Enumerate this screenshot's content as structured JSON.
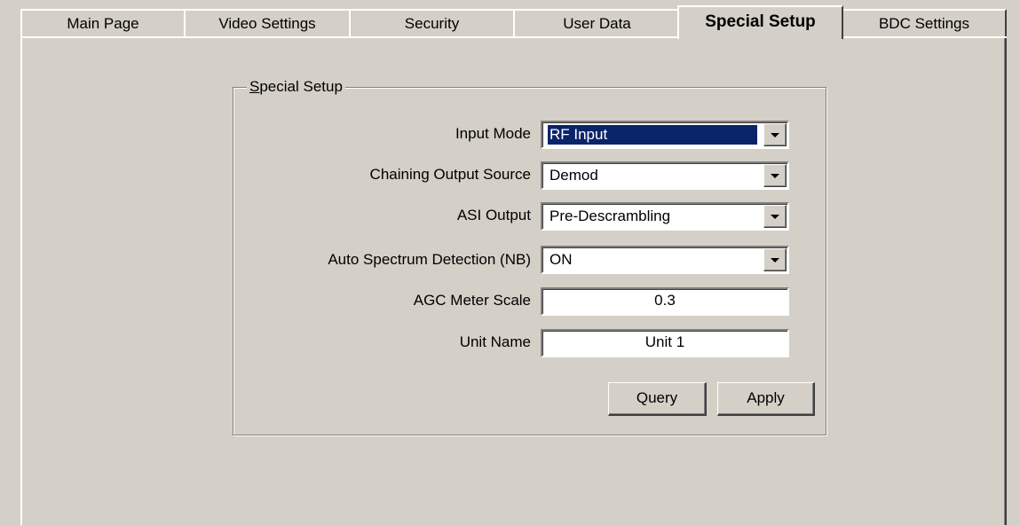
{
  "tabs": [
    {
      "label": "Main Page",
      "active": false
    },
    {
      "label": "Video Settings",
      "active": false
    },
    {
      "label": "Security",
      "active": false
    },
    {
      "label": "User Data",
      "active": false
    },
    {
      "label": "Special Setup",
      "active": true
    },
    {
      "label": "BDC Settings",
      "active": false
    }
  ],
  "group": {
    "title_mnemonic": "S",
    "title_rest": "pecial Setup"
  },
  "fields": {
    "input_mode": {
      "label": "Input Mode",
      "value": "RF Input"
    },
    "chaining_output_source": {
      "label": "Chaining Output Source",
      "value": "Demod"
    },
    "asi_output": {
      "label": "ASI Output",
      "value": "Pre-Descrambling"
    },
    "auto_spectrum_detection": {
      "label": "Auto Spectrum Detection (NB)",
      "value": "ON"
    },
    "agc_meter_scale": {
      "label": "AGC Meter Scale",
      "value": "0.3"
    },
    "unit_name": {
      "label": "Unit Name",
      "value": "Unit 1"
    }
  },
  "buttons": {
    "query": "Query",
    "apply": "Apply"
  },
  "icons": {
    "dropdown": "chevron-down-icon"
  },
  "colors": {
    "face": "#d4d0c8",
    "selection": "#0a246a"
  }
}
